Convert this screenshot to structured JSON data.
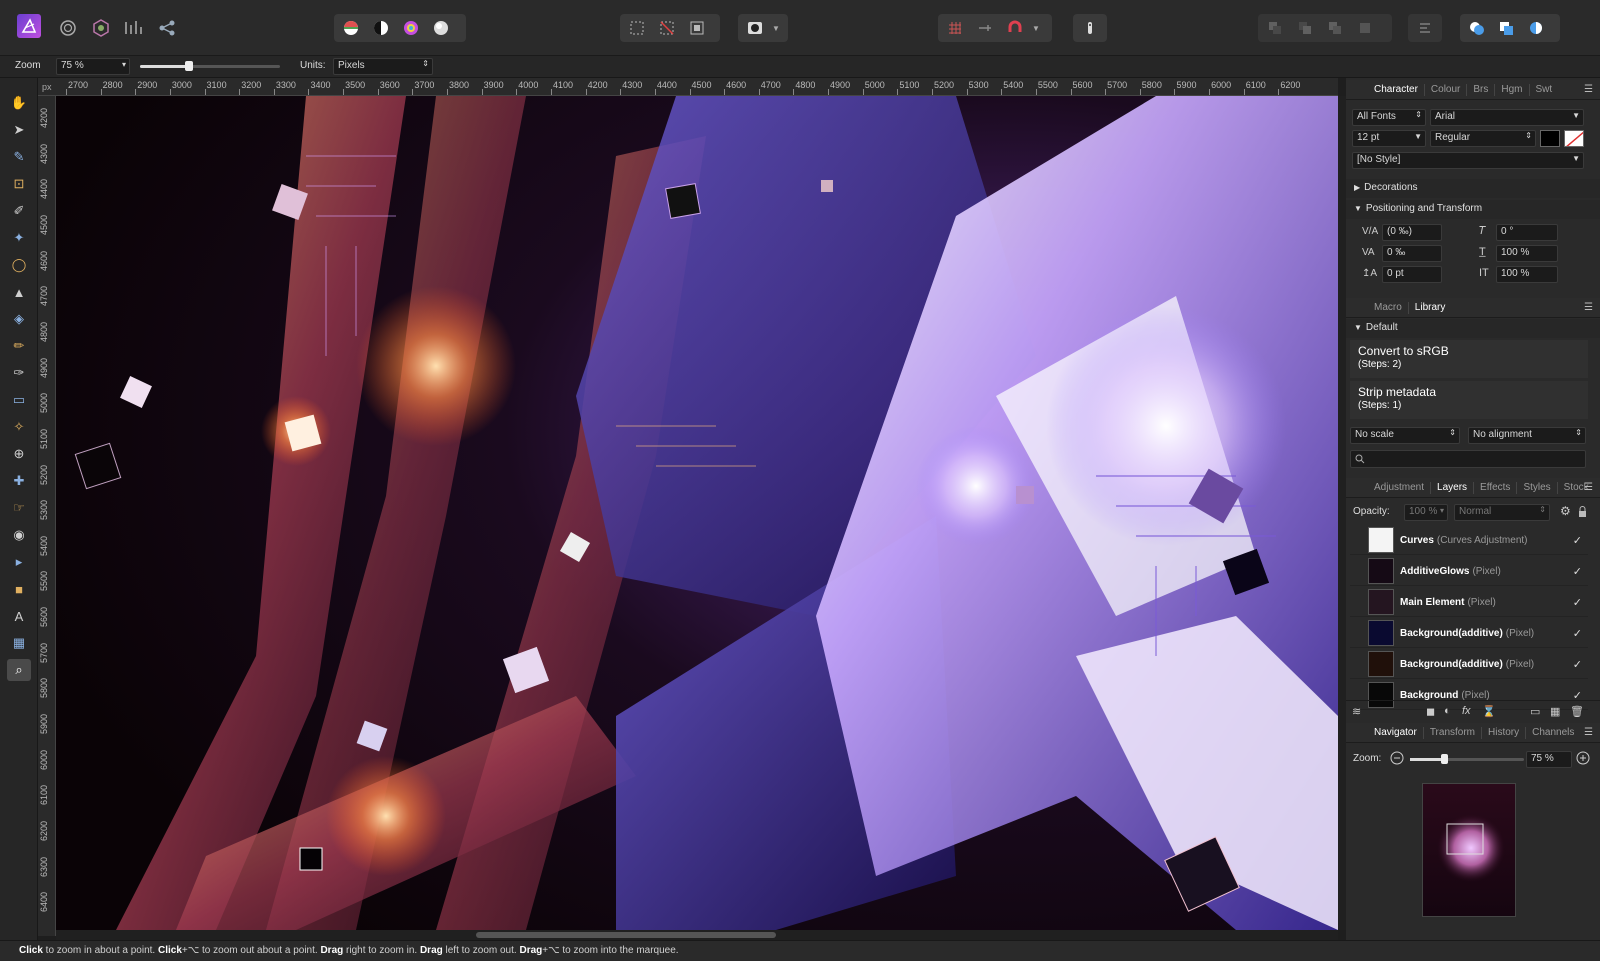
{
  "toolbar": {
    "app_icon": "affinity-photo-logo",
    "persona_icons": [
      "photo-persona-icon",
      "liquify-persona-icon",
      "develop-persona-icon",
      "tone-mapping-persona-icon",
      "export-persona-icon"
    ],
    "adjust_icons": [
      "auto-levels-icon",
      "auto-contrast-icon",
      "auto-colours-icon",
      "auto-white-balance-icon"
    ],
    "selection_icons": [
      "select-all-icon",
      "deselect-icon",
      "invert-selection-icon"
    ],
    "mode_icons": [
      "quick-mask-icon"
    ],
    "snap_icons": [
      "grid-icon",
      "align-icon",
      "snapping-magnet-icon"
    ],
    "right_icons": [
      "assistant-icon",
      "arrange-icon",
      "arrange-icon",
      "arrange-icon",
      "arrange-icon",
      "align-icon",
      "boolean-add-icon",
      "boolean-subtract-icon",
      "boolean-intersect-icon"
    ]
  },
  "context": {
    "zoom_label": "Zoom",
    "zoom_value": "75 %",
    "zoom_slider_fraction": 0.35,
    "units_label": "Units:",
    "units_value": "Pixels"
  },
  "rulers": {
    "unit": "px",
    "h_ticks": [
      "2700",
      "2800",
      "2900",
      "3000",
      "3100",
      "3200",
      "3300",
      "3400",
      "3500",
      "3600",
      "3700",
      "3800",
      "3900",
      "4000",
      "4100",
      "4200",
      "4300",
      "4400",
      "4500",
      "4600",
      "4700",
      "4800",
      "4900",
      "5000",
      "5100",
      "5200",
      "5300",
      "5400",
      "5500",
      "5600",
      "5700",
      "5800",
      "5900",
      "6000",
      "6100",
      "6200"
    ],
    "v_ticks": [
      "4200",
      "4300",
      "4400",
      "4500",
      "4600",
      "4700",
      "4800",
      "4900",
      "5000",
      "5100",
      "5200",
      "5300",
      "5400",
      "5500",
      "5600",
      "5700",
      "5800",
      "5900",
      "6000",
      "6100",
      "6200",
      "6300",
      "6400"
    ]
  },
  "tools": [
    "hand-tool-icon",
    "move-tool-icon",
    "color-picker-tool-icon",
    "crop-tool-icon",
    "selection-brush-tool-icon",
    "flood-select-tool-icon",
    "marquee-tool-icon",
    "flood-fill-tool-icon",
    "gradient-tool-icon",
    "paint-brush-tool-icon",
    "colour-replacement-tool-icon",
    "erase-brush-tool-icon",
    "dodge-brush-tool-icon",
    "clone-brush-tool-icon",
    "blemish-removal-tool-icon",
    "smudge-tool-icon",
    "red-eye-tool-icon",
    "node-tool-icon",
    "rectangle-tool-icon",
    "artistic-text-tool-icon",
    "mesh-warp-tool-icon",
    "zoom-tool-icon"
  ],
  "character_panel": {
    "tabs": [
      "Character",
      "Colour",
      "Brs",
      "Hgm",
      "Swt"
    ],
    "active_tab": "Character",
    "font_collection": "All Fonts",
    "font_family": "Arial",
    "font_size": "12 pt",
    "font_style": "Regular",
    "style": "[No Style]",
    "sections": [
      "Decorations",
      "Positioning and Transform"
    ],
    "rows": [
      {
        "left": "(0 ‰)",
        "right": "0 °"
      },
      {
        "left": "0 ‰",
        "right": "100 %"
      },
      {
        "left": "0 pt",
        "right": "100 %"
      }
    ]
  },
  "library_panel": {
    "tabs": [
      "Macro",
      "Library"
    ],
    "active_tab": "Library",
    "category": "Default",
    "macros": [
      {
        "title": "Convert to sRGB",
        "steps": "(Steps: 2)"
      },
      {
        "title": "Strip metadata",
        "steps": "(Steps: 1)"
      }
    ],
    "scale": "No scale",
    "alignment": "No alignment"
  },
  "layers_panel": {
    "tabs": [
      "Adjustment",
      "Layers",
      "Effects",
      "Styles",
      "Stock"
    ],
    "active_tab": "Layers",
    "opacity_label": "Opacity:",
    "opacity_value": "100 %",
    "blend_mode": "Normal",
    "layers": [
      {
        "name": "Curves",
        "type": "(Curves Adjustment)",
        "visible": "✓"
      },
      {
        "name": "AdditiveGlows",
        "type": "(Pixel)",
        "visible": "✓"
      },
      {
        "name": "Main Element",
        "type": "(Pixel)",
        "visible": "✓"
      },
      {
        "name": "Background(additive)",
        "type": "(Pixel)",
        "visible": "✓"
      },
      {
        "name": "Background(additive)",
        "type": "(Pixel)",
        "visible": "✓"
      },
      {
        "name": "Background",
        "type": "(Pixel)",
        "visible": "✓"
      }
    ],
    "footer_icons": [
      "layers-stack-icon",
      "mask-icon",
      "adjustment-icon",
      "fx-icon",
      "live-filter-icon",
      "group-icon",
      "pixel-layer-icon",
      "trash-icon"
    ]
  },
  "navigator_panel": {
    "tabs": [
      "Navigator",
      "Transform",
      "History",
      "Channels"
    ],
    "active_tab": "Navigator",
    "zoom_label": "Zoom:",
    "zoom_value": "75 %",
    "zoom_slider_fraction": 0.3
  },
  "status": {
    "prefix_bold": "Click",
    "t1": " to zoom in about a point. ",
    "b2": "Click",
    "t2": "+⌥ to zoom out about a point. ",
    "b3": "Drag",
    "t3": " right to zoom in. ",
    "b4": "Drag",
    "t4": " left to zoom out. ",
    "b5": "Drag",
    "t5": "+⌥ to zoom into the marquee."
  },
  "colors": {
    "accent": "#4a9ce8",
    "canvas_bg": "#0c0508",
    "glow_orange": "#ff9a4a",
    "glow_purple": "#9a7cff"
  }
}
